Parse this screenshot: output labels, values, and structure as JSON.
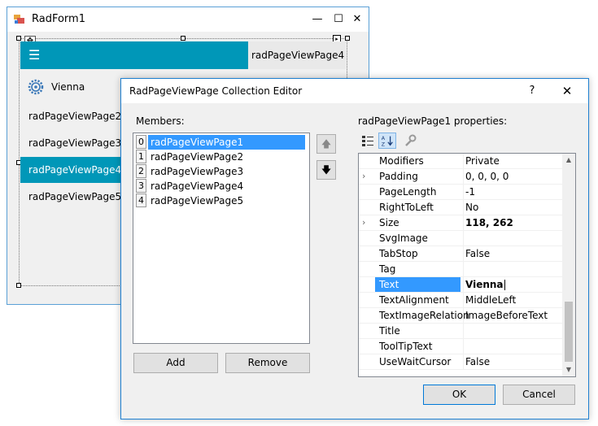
{
  "form": {
    "title": "RadForm1",
    "min_glyph": "—",
    "max_glyph": "☐",
    "close_glyph": "✕",
    "move_glyph": "✥",
    "smart_tag_glyph": "▸",
    "hamburger_glyph": "☰",
    "tab4_label": "radPageViewPage4",
    "nav_items": [
      {
        "label": "Vienna",
        "icon": "gear-icon"
      },
      {
        "label": "radPageViewPage2"
      },
      {
        "label": "radPageViewPage3"
      },
      {
        "label": "radPageViewPage4",
        "selected": true
      },
      {
        "label": "radPageViewPage5"
      }
    ],
    "accent": "#0097b8"
  },
  "dialog": {
    "title": "RadPageViewPage Collection Editor",
    "help_glyph": "?",
    "close_glyph": "✕",
    "members_label": "Members:",
    "members": [
      {
        "index": "0",
        "name": "radPageViewPage1",
        "selected": true
      },
      {
        "index": "1",
        "name": "radPageViewPage2"
      },
      {
        "index": "2",
        "name": "radPageViewPage3"
      },
      {
        "index": "3",
        "name": "radPageViewPage4"
      },
      {
        "index": "4",
        "name": "radPageViewPage5"
      }
    ],
    "up_glyph": "🡅",
    "down_glyph": "🡇",
    "add_label": "Add",
    "remove_label": "Remove",
    "properties_label": "radPageViewPage1 properties:",
    "properties": [
      {
        "name": "Modifiers",
        "value": "Private"
      },
      {
        "name": "Padding",
        "value": "0, 0, 0, 0",
        "expandable": true
      },
      {
        "name": "PageLength",
        "value": "-1"
      },
      {
        "name": "RightToLeft",
        "value": "No"
      },
      {
        "name": "Size",
        "value": "118, 262",
        "expandable": true,
        "bold": true
      },
      {
        "name": "SvgImage",
        "value": ""
      },
      {
        "name": "TabStop",
        "value": "False"
      },
      {
        "name": "Tag",
        "value": ""
      },
      {
        "name": "Text",
        "value": "Vienna",
        "selected": true,
        "bold": true
      },
      {
        "name": "TextAlignment",
        "value": "MiddleLeft"
      },
      {
        "name": "TextImageRelation",
        "value": "ImageBeforeText"
      },
      {
        "name": "Title",
        "value": ""
      },
      {
        "name": "ToolTipText",
        "value": ""
      },
      {
        "name": "UseWaitCursor",
        "value": "False"
      }
    ],
    "expand_glyph": "›",
    "scroll_up_glyph": "▲",
    "scroll_down_glyph": "▼",
    "ok_label": "OK",
    "cancel_label": "Cancel",
    "selection_color": "#3399ff"
  }
}
